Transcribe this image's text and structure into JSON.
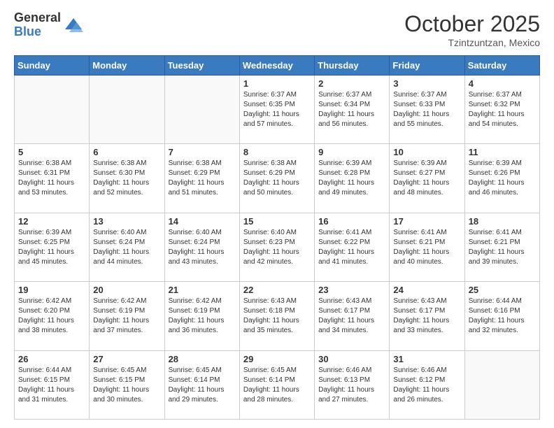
{
  "header": {
    "logo": {
      "general": "General",
      "blue": "Blue"
    },
    "title": "October 2025",
    "location": "Tzintzuntzan, Mexico"
  },
  "weekdays": [
    "Sunday",
    "Monday",
    "Tuesday",
    "Wednesday",
    "Thursday",
    "Friday",
    "Saturday"
  ],
  "weeks": [
    [
      {
        "day": "",
        "info": ""
      },
      {
        "day": "",
        "info": ""
      },
      {
        "day": "",
        "info": ""
      },
      {
        "day": "1",
        "info": "Sunrise: 6:37 AM\nSunset: 6:35 PM\nDaylight: 11 hours\nand 57 minutes."
      },
      {
        "day": "2",
        "info": "Sunrise: 6:37 AM\nSunset: 6:34 PM\nDaylight: 11 hours\nand 56 minutes."
      },
      {
        "day": "3",
        "info": "Sunrise: 6:37 AM\nSunset: 6:33 PM\nDaylight: 11 hours\nand 55 minutes."
      },
      {
        "day": "4",
        "info": "Sunrise: 6:37 AM\nSunset: 6:32 PM\nDaylight: 11 hours\nand 54 minutes."
      }
    ],
    [
      {
        "day": "5",
        "info": "Sunrise: 6:38 AM\nSunset: 6:31 PM\nDaylight: 11 hours\nand 53 minutes."
      },
      {
        "day": "6",
        "info": "Sunrise: 6:38 AM\nSunset: 6:30 PM\nDaylight: 11 hours\nand 52 minutes."
      },
      {
        "day": "7",
        "info": "Sunrise: 6:38 AM\nSunset: 6:29 PM\nDaylight: 11 hours\nand 51 minutes."
      },
      {
        "day": "8",
        "info": "Sunrise: 6:38 AM\nSunset: 6:29 PM\nDaylight: 11 hours\nand 50 minutes."
      },
      {
        "day": "9",
        "info": "Sunrise: 6:39 AM\nSunset: 6:28 PM\nDaylight: 11 hours\nand 49 minutes."
      },
      {
        "day": "10",
        "info": "Sunrise: 6:39 AM\nSunset: 6:27 PM\nDaylight: 11 hours\nand 48 minutes."
      },
      {
        "day": "11",
        "info": "Sunrise: 6:39 AM\nSunset: 6:26 PM\nDaylight: 11 hours\nand 46 minutes."
      }
    ],
    [
      {
        "day": "12",
        "info": "Sunrise: 6:39 AM\nSunset: 6:25 PM\nDaylight: 11 hours\nand 45 minutes."
      },
      {
        "day": "13",
        "info": "Sunrise: 6:40 AM\nSunset: 6:24 PM\nDaylight: 11 hours\nand 44 minutes."
      },
      {
        "day": "14",
        "info": "Sunrise: 6:40 AM\nSunset: 6:24 PM\nDaylight: 11 hours\nand 43 minutes."
      },
      {
        "day": "15",
        "info": "Sunrise: 6:40 AM\nSunset: 6:23 PM\nDaylight: 11 hours\nand 42 minutes."
      },
      {
        "day": "16",
        "info": "Sunrise: 6:41 AM\nSunset: 6:22 PM\nDaylight: 11 hours\nand 41 minutes."
      },
      {
        "day": "17",
        "info": "Sunrise: 6:41 AM\nSunset: 6:21 PM\nDaylight: 11 hours\nand 40 minutes."
      },
      {
        "day": "18",
        "info": "Sunrise: 6:41 AM\nSunset: 6:21 PM\nDaylight: 11 hours\nand 39 minutes."
      }
    ],
    [
      {
        "day": "19",
        "info": "Sunrise: 6:42 AM\nSunset: 6:20 PM\nDaylight: 11 hours\nand 38 minutes."
      },
      {
        "day": "20",
        "info": "Sunrise: 6:42 AM\nSunset: 6:19 PM\nDaylight: 11 hours\nand 37 minutes."
      },
      {
        "day": "21",
        "info": "Sunrise: 6:42 AM\nSunset: 6:19 PM\nDaylight: 11 hours\nand 36 minutes."
      },
      {
        "day": "22",
        "info": "Sunrise: 6:43 AM\nSunset: 6:18 PM\nDaylight: 11 hours\nand 35 minutes."
      },
      {
        "day": "23",
        "info": "Sunrise: 6:43 AM\nSunset: 6:17 PM\nDaylight: 11 hours\nand 34 minutes."
      },
      {
        "day": "24",
        "info": "Sunrise: 6:43 AM\nSunset: 6:17 PM\nDaylight: 11 hours\nand 33 minutes."
      },
      {
        "day": "25",
        "info": "Sunrise: 6:44 AM\nSunset: 6:16 PM\nDaylight: 11 hours\nand 32 minutes."
      }
    ],
    [
      {
        "day": "26",
        "info": "Sunrise: 6:44 AM\nSunset: 6:15 PM\nDaylight: 11 hours\nand 31 minutes."
      },
      {
        "day": "27",
        "info": "Sunrise: 6:45 AM\nSunset: 6:15 PM\nDaylight: 11 hours\nand 30 minutes."
      },
      {
        "day": "28",
        "info": "Sunrise: 6:45 AM\nSunset: 6:14 PM\nDaylight: 11 hours\nand 29 minutes."
      },
      {
        "day": "29",
        "info": "Sunrise: 6:45 AM\nSunset: 6:14 PM\nDaylight: 11 hours\nand 28 minutes."
      },
      {
        "day": "30",
        "info": "Sunrise: 6:46 AM\nSunset: 6:13 PM\nDaylight: 11 hours\nand 27 minutes."
      },
      {
        "day": "31",
        "info": "Sunrise: 6:46 AM\nSunset: 6:12 PM\nDaylight: 11 hours\nand 26 minutes."
      },
      {
        "day": "",
        "info": ""
      }
    ]
  ]
}
